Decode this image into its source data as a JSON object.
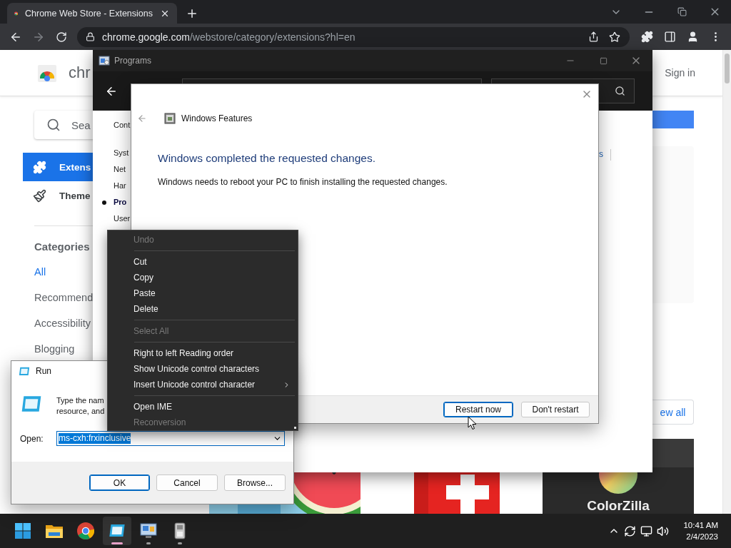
{
  "browser": {
    "tab": {
      "title": "Chrome Web Store - Extensions",
      "selected": true
    },
    "address": {
      "host": "chrome.google.com",
      "path": "/webstore/category/extensions?hl=en"
    },
    "store": {
      "logo_text": "chr",
      "sign_in": "Sign in",
      "search": {
        "placeholder": "Sea"
      },
      "nav": [
        {
          "kind": "extensions",
          "label": "Extens",
          "selected": true
        },
        {
          "kind": "themes",
          "label": "Theme",
          "selected": false
        }
      ],
      "categories": {
        "title": "Categories",
        "items": [
          {
            "label": "All",
            "selected": true
          },
          {
            "label": "Recommend",
            "selected": false
          },
          {
            "label": "Accessibility",
            "selected": false
          },
          {
            "label": "Blogging",
            "selected": false
          }
        ]
      },
      "view_all": "ew all",
      "tiles": [
        {
          "kind": "watermelon"
        },
        {
          "kind": "red"
        },
        {
          "kind": "colorwheel",
          "caption": "ColorZilla"
        }
      ]
    }
  },
  "programs": {
    "title": "Programs",
    "nav_heading": "Cont",
    "nav": [
      {
        "label": "Syst",
        "selected": false
      },
      {
        "label": "Net",
        "selected": false
      },
      {
        "label": "Har",
        "selected": false
      },
      {
        "label": "Pro",
        "selected": true
      },
      {
        "label": "User",
        "selected": false
      }
    ],
    "link": "s"
  },
  "features": {
    "title": "Windows Features",
    "heading": "Windows completed the requested changes.",
    "message": "Windows needs to reboot your PC to finish installing the requested changes.",
    "buttons": [
      {
        "label": "Restart now",
        "selected": true
      },
      {
        "label": "Don't restart",
        "selected": false
      }
    ]
  },
  "context_menu": [
    {
      "kind": "item",
      "label": "Undo",
      "disabled": true
    },
    {
      "kind": "separator"
    },
    {
      "kind": "item",
      "label": "Cut",
      "disabled": false
    },
    {
      "kind": "item",
      "label": "Copy",
      "disabled": false
    },
    {
      "kind": "item",
      "label": "Paste",
      "disabled": false
    },
    {
      "kind": "item",
      "label": "Delete",
      "disabled": false
    },
    {
      "kind": "separator"
    },
    {
      "kind": "item",
      "label": "Select All",
      "disabled": true
    },
    {
      "kind": "separator"
    },
    {
      "kind": "item",
      "label": "Right to left Reading order",
      "disabled": false
    },
    {
      "kind": "item",
      "label": "Show Unicode control characters",
      "disabled": false
    },
    {
      "kind": "submenu",
      "label": "Insert Unicode control character",
      "disabled": false
    },
    {
      "kind": "separator"
    },
    {
      "kind": "item",
      "label": "Open IME",
      "disabled": false
    },
    {
      "kind": "item",
      "label": "Reconversion",
      "disabled": true
    }
  ],
  "run": {
    "title": "Run",
    "description": [
      "Type the nam",
      "resource, and"
    ],
    "open_label": "Open:",
    "value": "ms-cxh:frxinclusive",
    "buttons": [
      {
        "label": "OK",
        "selected": true
      },
      {
        "label": "Cancel",
        "selected": false
      },
      {
        "label": "Browse...",
        "selected": false
      }
    ]
  },
  "taskbar": {
    "apps": [
      {
        "kind": "start",
        "running": false,
        "active": false
      },
      {
        "kind": "folder",
        "running": false,
        "active": false
      },
      {
        "kind": "browser",
        "running": false,
        "active": false
      },
      {
        "kind": "run",
        "running": true,
        "active": true
      },
      {
        "kind": "control_panel",
        "running": true,
        "active": false
      },
      {
        "kind": "device",
        "running": true,
        "active": false
      }
    ],
    "time": "10:41 AM",
    "date": "2/4/2023"
  }
}
